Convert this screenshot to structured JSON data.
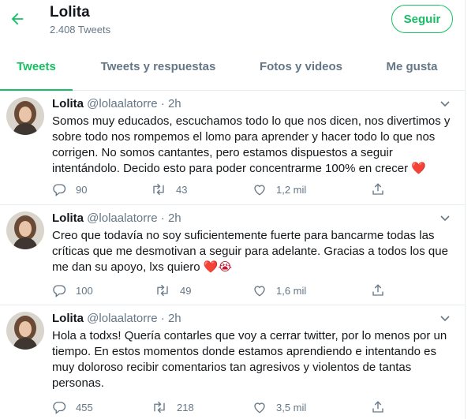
{
  "header": {
    "title": "Lolita",
    "subtitle": "2.408 Tweets",
    "follow_label": "Seguir"
  },
  "tabs": [
    {
      "label": "Tweets",
      "active": true
    },
    {
      "label": "Tweets y respuestas",
      "active": false
    },
    {
      "label": "Fotos y videos",
      "active": false
    },
    {
      "label": "Me gusta",
      "active": false
    }
  ],
  "tweets": [
    {
      "name": "Lolita",
      "handle": "@lolaalatorre",
      "separator": "·",
      "time": "2h",
      "text": "Somos muy educados, escuchamos todo lo que nos dicen, nos divertimos y sobre todo nos rompemos el lomo para aprender y hacer todo lo que nos corrigen. No somos cantantes, pero estamos dispuestos a seguir intentándolo. Decido esto para poder concentrarme 100% en crecer",
      "emoji": "❤️",
      "replies": "90",
      "retweets": "43",
      "likes": "1,2 mil"
    },
    {
      "name": "Lolita",
      "handle": "@lolaalatorre",
      "separator": "·",
      "time": "2h",
      "text": "Creo que todavía no soy suficientemente fuerte para bancarme todas las críticas que me desmotivan a seguir para adelante. Gracias a todos los que me dan su apoyo, lxs quiero",
      "emoji": "❤️😭",
      "replies": "100",
      "retweets": "49",
      "likes": "1,6 mil"
    },
    {
      "name": "Lolita",
      "handle": "@lolaalatorre",
      "separator": "·",
      "time": "2h",
      "text": "Hola a todxs! Quería contarles que voy a cerrar twitter, por lo menos por un tiempo. En estos momentos donde estamos aprendiendo e intentando es muy doloroso recibir comentarios tan agresivos y violentos de tantas personas.",
      "emoji": "",
      "replies": "455",
      "retweets": "218",
      "likes": "3,5 mil"
    }
  ],
  "colors": {
    "accent": "#17bf63",
    "text": "#14171a",
    "muted": "#657786",
    "divider": "#e6ecf0",
    "heart": "#be1931"
  },
  "icons": [
    "back-arrow-icon",
    "chevron-down-icon",
    "reply-icon",
    "retweet-icon",
    "like-icon",
    "share-icon"
  ]
}
